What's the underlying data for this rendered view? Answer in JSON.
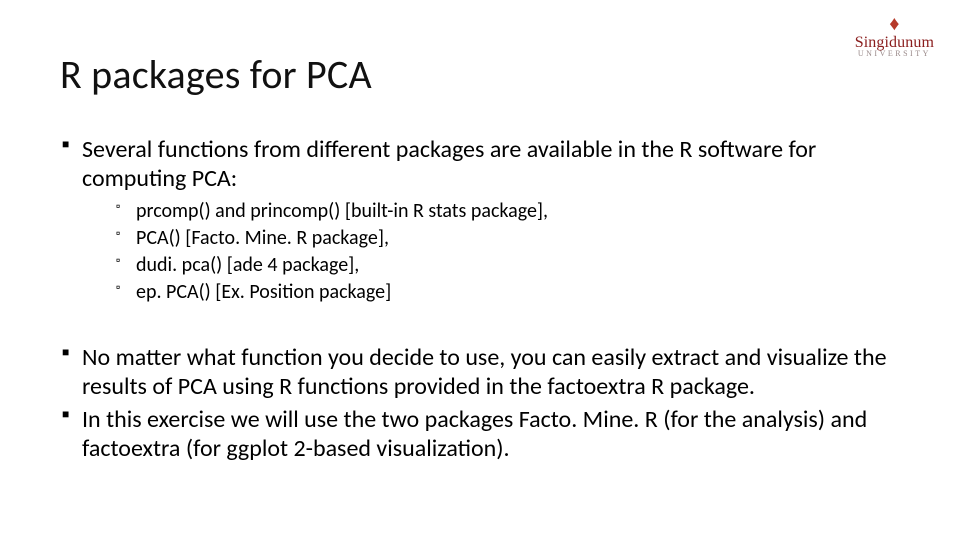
{
  "brand": {
    "name": "Singidunum",
    "sub": "UNIVERSITY"
  },
  "title": "R packages for PCA",
  "bullets": {
    "p1": "Several functions from different packages are available in the R software for computing PCA:",
    "sub": [
      "prcomp() and princomp() [built-in R stats package],",
      "PCA() [Facto. Mine. R package],",
      "dudi. pca() [ade 4 package],",
      "ep. PCA() [Ex. Position package]"
    ],
    "p2": "No matter what function you decide to use, you can easily extract and visualize the results of PCA using R functions provided in the factoextra R package.",
    "p3": "In this exercise we will use the two packages Facto. Mine. R (for the analysis) and factoextra (for ggplot 2-based visualization)."
  }
}
